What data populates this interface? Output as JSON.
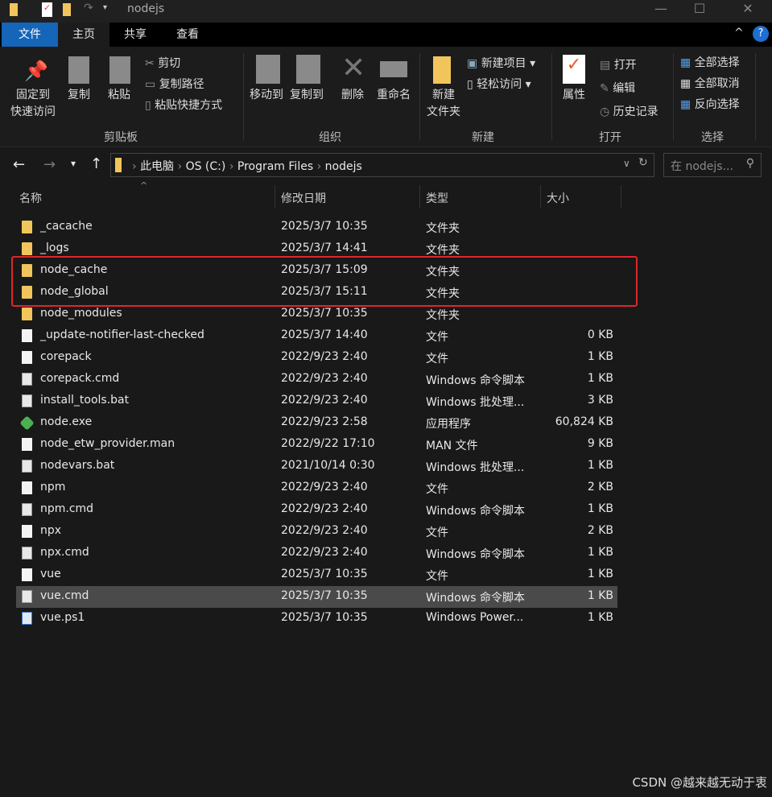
{
  "window": {
    "title": "nodejs",
    "minimize": "—",
    "maximize": "☐",
    "close": "✕"
  },
  "tabs": [
    {
      "label": "文件"
    },
    {
      "label": "主页"
    },
    {
      "label": "共享"
    },
    {
      "label": "查看"
    }
  ],
  "ribbon": {
    "clipboard": {
      "label": "剪贴板",
      "pin": "固定到",
      "pin2": "快速访问",
      "copy": "复制",
      "paste": "粘贴",
      "cut": "剪切",
      "copy_path": "复制路径",
      "paste_shortcut": "粘贴快捷方式"
    },
    "organize": {
      "label": "组织",
      "move_to": "移动到",
      "copy_to": "复制到",
      "delete": "删除",
      "rename": "重命名"
    },
    "new": {
      "label": "新建",
      "new_folder": "新建",
      "new_folder2": "文件夹",
      "new_item": "新建项目",
      "easy_access": "轻松访问"
    },
    "open": {
      "label": "打开",
      "properties": "属性",
      "open": "打开",
      "edit": "编辑",
      "history": "历史记录"
    },
    "select": {
      "label": "选择",
      "select_all": "全部选择",
      "select_none": "全部取消",
      "invert": "反向选择"
    }
  },
  "address": {
    "crumbs": [
      "此电脑",
      "OS (C:)",
      "Program Files",
      "nodejs"
    ],
    "search_placeholder": "在 nodejs..."
  },
  "columns": {
    "name": "名称",
    "date": "修改日期",
    "type": "类型",
    "size": "大小"
  },
  "files": [
    {
      "name": "_cacache",
      "date": "2025/3/7 10:35",
      "type": "文件夹",
      "size": "",
      "icon": "folder"
    },
    {
      "name": "_logs",
      "date": "2025/3/7 14:41",
      "type": "文件夹",
      "size": "",
      "icon": "folder"
    },
    {
      "name": "node_cache",
      "date": "2025/3/7 15:09",
      "type": "文件夹",
      "size": "",
      "icon": "folder"
    },
    {
      "name": "node_global",
      "date": "2025/3/7 15:11",
      "type": "文件夹",
      "size": "",
      "icon": "folder"
    },
    {
      "name": "node_modules",
      "date": "2025/3/7 10:35",
      "type": "文件夹",
      "size": "",
      "icon": "folder"
    },
    {
      "name": "_update-notifier-last-checked",
      "date": "2025/3/7 14:40",
      "type": "文件",
      "size": "0 KB",
      "icon": "file"
    },
    {
      "name": "corepack",
      "date": "2022/9/23 2:40",
      "type": "文件",
      "size": "1 KB",
      "icon": "file"
    },
    {
      "name": "corepack.cmd",
      "date": "2022/9/23 2:40",
      "type": "Windows 命令脚本",
      "size": "1 KB",
      "icon": "cmd"
    },
    {
      "name": "install_tools.bat",
      "date": "2022/9/23 2:40",
      "type": "Windows 批处理...",
      "size": "3 KB",
      "icon": "cmd"
    },
    {
      "name": "node.exe",
      "date": "2022/9/23 2:58",
      "type": "应用程序",
      "size": "60,824 KB",
      "icon": "exe"
    },
    {
      "name": "node_etw_provider.man",
      "date": "2022/9/22 17:10",
      "type": "MAN 文件",
      "size": "9 KB",
      "icon": "file"
    },
    {
      "name": "nodevars.bat",
      "date": "2021/10/14 0:30",
      "type": "Windows 批处理...",
      "size": "1 KB",
      "icon": "cmd"
    },
    {
      "name": "npm",
      "date": "2022/9/23 2:40",
      "type": "文件",
      "size": "2 KB",
      "icon": "file"
    },
    {
      "name": "npm.cmd",
      "date": "2022/9/23 2:40",
      "type": "Windows 命令脚本",
      "size": "1 KB",
      "icon": "cmd"
    },
    {
      "name": "npx",
      "date": "2022/9/23 2:40",
      "type": "文件",
      "size": "2 KB",
      "icon": "file"
    },
    {
      "name": "npx.cmd",
      "date": "2022/9/23 2:40",
      "type": "Windows 命令脚本",
      "size": "1 KB",
      "icon": "cmd"
    },
    {
      "name": "vue",
      "date": "2025/3/7 10:35",
      "type": "文件",
      "size": "1 KB",
      "icon": "file"
    },
    {
      "name": "vue.cmd",
      "date": "2025/3/7 10:35",
      "type": "Windows 命令脚本",
      "size": "1 KB",
      "icon": "cmd",
      "selected": true
    },
    {
      "name": "vue.ps1",
      "date": "2025/3/7 10:35",
      "type": "Windows Power...",
      "size": "1 KB",
      "icon": "ps"
    }
  ],
  "watermark": "CSDN @越来越无动于衷"
}
